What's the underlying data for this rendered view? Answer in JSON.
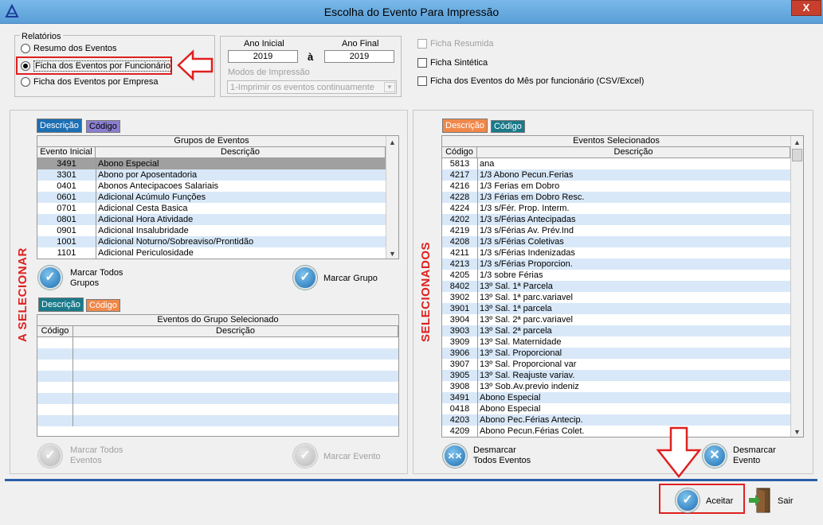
{
  "window": {
    "title": "Escolha do Evento Para Impressão",
    "close_label": "X"
  },
  "relatorios": {
    "legend": "Relatórios",
    "options": [
      {
        "label": "Resumo dos Eventos",
        "selected": false
      },
      {
        "label": "Ficha dos Eventos por Funcionário",
        "selected": true
      },
      {
        "label": "Ficha dos Eventos por Empresa",
        "selected": false
      }
    ]
  },
  "anos": {
    "inicial_label": "Ano Inicial",
    "inicial_value": "2019",
    "separator": "à",
    "final_label": "Ano Final",
    "final_value": "2019",
    "modos_label": "Modos de Impressão",
    "modos_value": "1-Imprimir os eventos continuamente"
  },
  "checks": [
    {
      "label": "Ficha Resumida",
      "checked": false,
      "disabled": true
    },
    {
      "label": "Ficha Sintética",
      "checked": false,
      "disabled": false
    },
    {
      "label": "Ficha dos Eventos do Mês por funcionário  (CSV/Excel)",
      "checked": false,
      "disabled": false
    }
  ],
  "left": {
    "vertical_label": "A SELECIONAR",
    "tabs": [
      "Descrição",
      "Código"
    ],
    "grid_title": "Grupos de Eventos",
    "col1": "Evento Inicial",
    "col2": "Descrição",
    "rows": [
      [
        "3491",
        "Abono Especial"
      ],
      [
        "3301",
        "Abono por Aposentadoria"
      ],
      [
        "0401",
        "Abonos Antecipacoes Salariais"
      ],
      [
        "0601",
        "Adicional Acúmulo Funções"
      ],
      [
        "0701",
        "Adicional Cesta Basica"
      ],
      [
        "0801",
        "Adicional Hora Atividade"
      ],
      [
        "0901",
        "Adicional Insalubridade"
      ],
      [
        "1001",
        "Adicional Noturno/Sobreaviso/Prontidão"
      ],
      [
        "1101",
        "Adicional Periculosidade"
      ]
    ],
    "btn_marcar_todos": "Marcar Todos Grupos",
    "btn_marcar_grupo": "Marcar Grupo",
    "tabs2": [
      "Descrição",
      "Código"
    ],
    "grid2_title": "Eventos do Grupo Selecionado",
    "col2_1": "Código",
    "col2_2": "Descrição",
    "btn_marcar_todos_eventos": "Marcar Todos Eventos",
    "btn_marcar_evento": "Marcar Evento"
  },
  "right": {
    "vertical_label": "SELECIONADOS",
    "tabs": [
      "Descrição",
      "Código"
    ],
    "grid_title": "Eventos Selecionados",
    "col1": "Código",
    "col2": "Descrição",
    "rows": [
      [
        "5813",
        "ana"
      ],
      [
        "4217",
        "1/3 Abono Pecun.Ferias"
      ],
      [
        "4216",
        "1/3 Ferias em Dobro"
      ],
      [
        "4228",
        "1/3 Férias em Dobro Resc."
      ],
      [
        "4224",
        "1/3 s/Fér. Prop. Interm."
      ],
      [
        "4202",
        "1/3 s/Férias Antecipadas"
      ],
      [
        "4219",
        "1/3 s/Férias Av. Prév.Ind"
      ],
      [
        "4208",
        "1/3 s/Férias Coletivas"
      ],
      [
        "4211",
        "1/3 s/Férias Indenizadas"
      ],
      [
        "4213",
        "1/3 s/Férias Proporcion."
      ],
      [
        "4205",
        "1/3 sobre Férias"
      ],
      [
        "8402",
        "13º Sal. 1ª Parcela"
      ],
      [
        "3902",
        "13º Sal. 1ª parc.variavel"
      ],
      [
        "3901",
        "13º Sal. 1ª parcela"
      ],
      [
        "3904",
        "13º Sal. 2ª parc.variavel"
      ],
      [
        "3903",
        "13º Sal. 2ª parcela"
      ],
      [
        "3909",
        "13º Sal. Maternidade"
      ],
      [
        "3906",
        "13º Sal. Proporcional"
      ],
      [
        "3907",
        "13º Sal. Proporcional var"
      ],
      [
        "3905",
        "13º Sal. Reajuste variav."
      ],
      [
        "3908",
        "13º Sob.Av.previo indeniz"
      ],
      [
        "3491",
        "Abono Especial"
      ],
      [
        "0418",
        "Abono Especial"
      ],
      [
        "4203",
        "Abono Pec.Férias Antecip."
      ],
      [
        "4209",
        "Abono Pecun.Férias Colet."
      ]
    ],
    "btn_desmarcar_todos": "Desmarcar Todos Eventos",
    "btn_desmarcar_evento": "Desmarcar Evento"
  },
  "footer": {
    "aceitar": "Aceitar",
    "sair": "Sair"
  },
  "colors": {
    "accent_red": "#e02020",
    "tab_active_blue": "#1d6fb3",
    "tab_purple": "#8a7fcf",
    "tab_orange": "#f0884a",
    "row_alt": "#d8e8f8"
  }
}
